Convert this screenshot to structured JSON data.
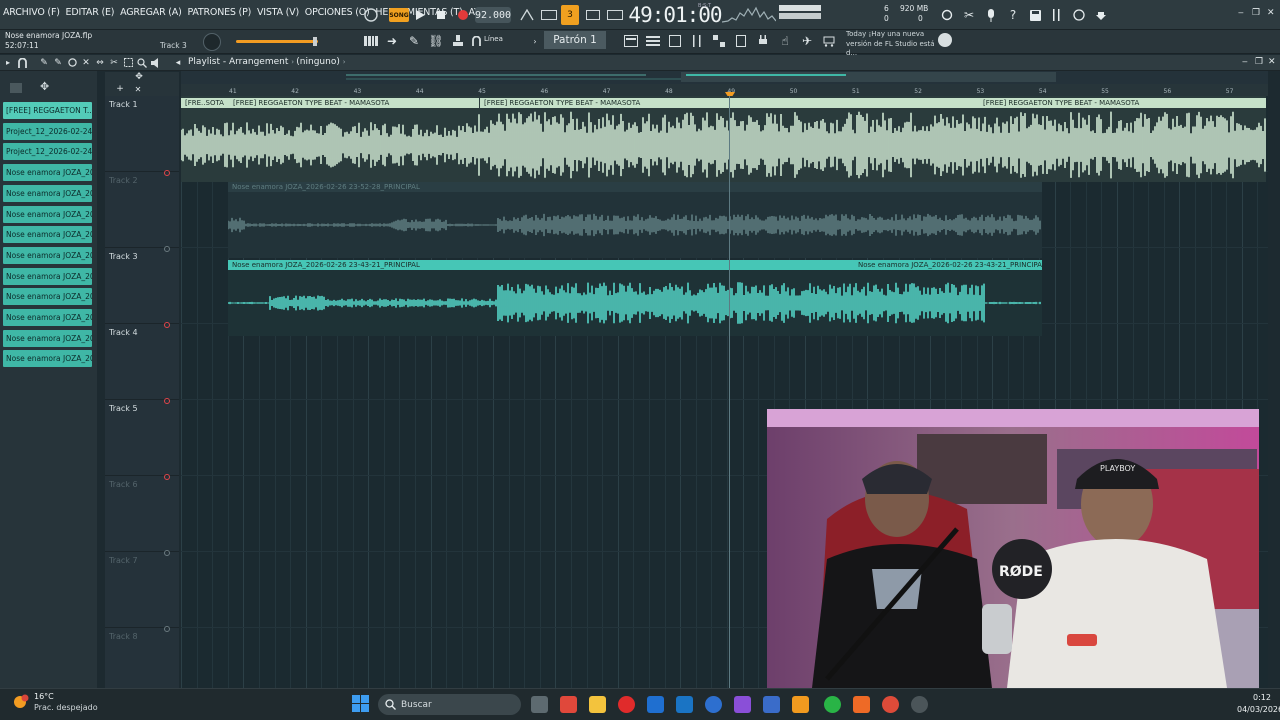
{
  "menu": {
    "items": [
      "ARCHIVO (F)",
      "EDITAR (E)",
      "AGREGAR (A)",
      "PATRONES (P)",
      "VISTA (V)",
      "OPCIONES (O)",
      "HERRAMIENTAS (T)",
      "AYUDA"
    ]
  },
  "transport": {
    "song_mode": "SONG",
    "tempo": "92.000",
    "time": "49:01:00",
    "time_sub": "B:S:T",
    "cpu_top": "6",
    "cpu_bot": "0",
    "mem_top": "920 MB",
    "mem_bot": "0"
  },
  "project": {
    "file": "Nose enamora JOZA.flp",
    "elapsed": "52:07:11",
    "hint": "Track 3"
  },
  "toolbar2": {
    "snap": "Línea",
    "pattern": "Patrón 1",
    "news_line1": "Today  ¡Hay una nueva",
    "news_line2": "versión de FL Studio está d..."
  },
  "playlist": {
    "title": "Playlist - Arrangement",
    "crumb": "(ninguno)"
  },
  "browser": {
    "clips": [
      "[FREE] REGGAETON T...",
      "Project_12_2026-02-24...",
      "Project_12_2026-02-24...",
      "Nose enamora JOZA_202...",
      "Nose enamora JOZA_202...",
      "Nose enamora JOZA_202...",
      "Nose enamora JOZA_202...",
      "Nose enamora JOZA_202...",
      "Nose enamora JOZA_202...",
      "Nose enamora JOZA_202...",
      "Nose enamora JOZA_202...",
      "Nose enamora JOZA_202...",
      "Nose enamora JOZA_202..."
    ]
  },
  "ruler": {
    "bars": [
      "41",
      "42",
      "43",
      "44",
      "45",
      "46",
      "47",
      "48",
      "49",
      "50",
      "51",
      "52",
      "53",
      "54",
      "55",
      "56",
      "57"
    ]
  },
  "tracks": [
    {
      "name": "Track 1",
      "dim": false
    },
    {
      "name": "Track 2",
      "dim": true
    },
    {
      "name": "Track 3",
      "dim": false
    },
    {
      "name": "Track 4",
      "dim": false
    },
    {
      "name": "Track 5",
      "dim": false
    },
    {
      "name": "Track 6",
      "dim": true
    },
    {
      "name": "Track 7",
      "dim": true
    },
    {
      "name": "Track 8",
      "dim": true
    }
  ],
  "clips": {
    "t1_a": "[FRE..SOTA",
    "t1_b": "[FREE] REGGAETON TYPE BEAT - MAMASOTA",
    "t1_c": "[FREE] REGGAETON TYPE BEAT - MAMASOTA",
    "t1_d": "[FREE] REGGAETON TYPE BEAT - MAMASOTA",
    "t2": "Nose enamora JOZA_2026-02-26 23-52-28_PRINCIPAL",
    "t3_a": "Nose enamora JOZA_2026-02-26 23-43-21_PRINCIPAL",
    "t3_b": "Nose enamora JOZA_2026-02-26 23-43-21_PRINCIPAL"
  },
  "webcam": {
    "mic_brand": "RØDE",
    "cap_text": "PLAYBOY"
  },
  "taskbar": {
    "temp": "16°C",
    "weather": "Prac. despejado",
    "search_placeholder": "Buscar",
    "time": "0:12",
    "date": "04/03/2026"
  },
  "colors": {
    "beat_clip": "#cfe8d3",
    "vocal_clip": "#54d6c8",
    "muted_clip": "#5f7d80",
    "accent": "#f39c22"
  }
}
